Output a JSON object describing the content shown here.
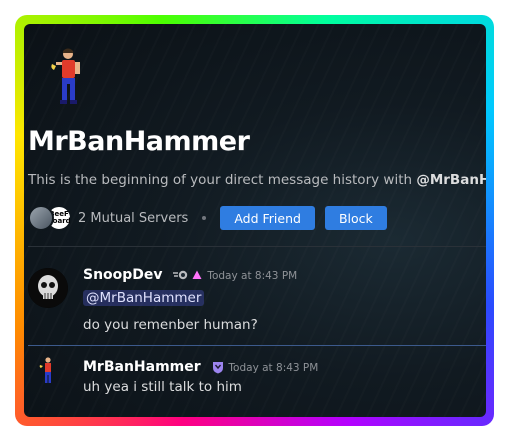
{
  "profile": {
    "name": "MrBanHammer",
    "intro_prefix": "This is the beginning of your direct message history with ",
    "intro_handle": "@MrBanHammer",
    "mutual_servers_label": "2 Mutual Servers",
    "mutual_server_2_text": "BeeF Board",
    "add_friend_label": "Add Friend",
    "block_label": "Block"
  },
  "messages": [
    {
      "author": "SnoopDev",
      "timestamp": "Today at 8:43 PM",
      "mention": "@MrBanHammer",
      "text": "do you remenber human?"
    },
    {
      "author": "MrBanHammer",
      "timestamp": "Today at 8:43 PM",
      "text": "uh yea i still talk to him"
    }
  ],
  "colors": {
    "button": "#2f7de1",
    "mention_bg": "#5865f2",
    "boost_badge": "#ff73fa"
  }
}
